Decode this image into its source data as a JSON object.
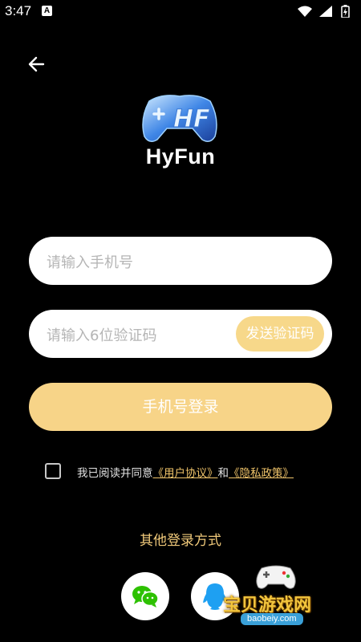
{
  "status_bar": {
    "time": "3:47",
    "notification_icon": "A"
  },
  "app": {
    "name": "HyFun",
    "logo_icon": "gamepad-hf-logo-icon"
  },
  "form": {
    "phone_placeholder": "请输入手机号",
    "code_placeholder": "请输入6位验证码",
    "send_code_label": "发送验证码",
    "login_label": "手机号登录"
  },
  "agreement": {
    "checked": false,
    "prefix": "我已阅读并同意",
    "user_agreement": "《用户协议》",
    "conjunction": "和",
    "privacy_policy": "《隐私政策》"
  },
  "other_login": {
    "title": "其他登录方式",
    "methods": [
      "wechat-icon",
      "qq-icon"
    ]
  },
  "watermark": {
    "text": "宝贝游戏网",
    "url": "baobeiy.com"
  },
  "colors": {
    "background": "#000000",
    "accent": "#f7d488",
    "link": "#f0c46a"
  }
}
